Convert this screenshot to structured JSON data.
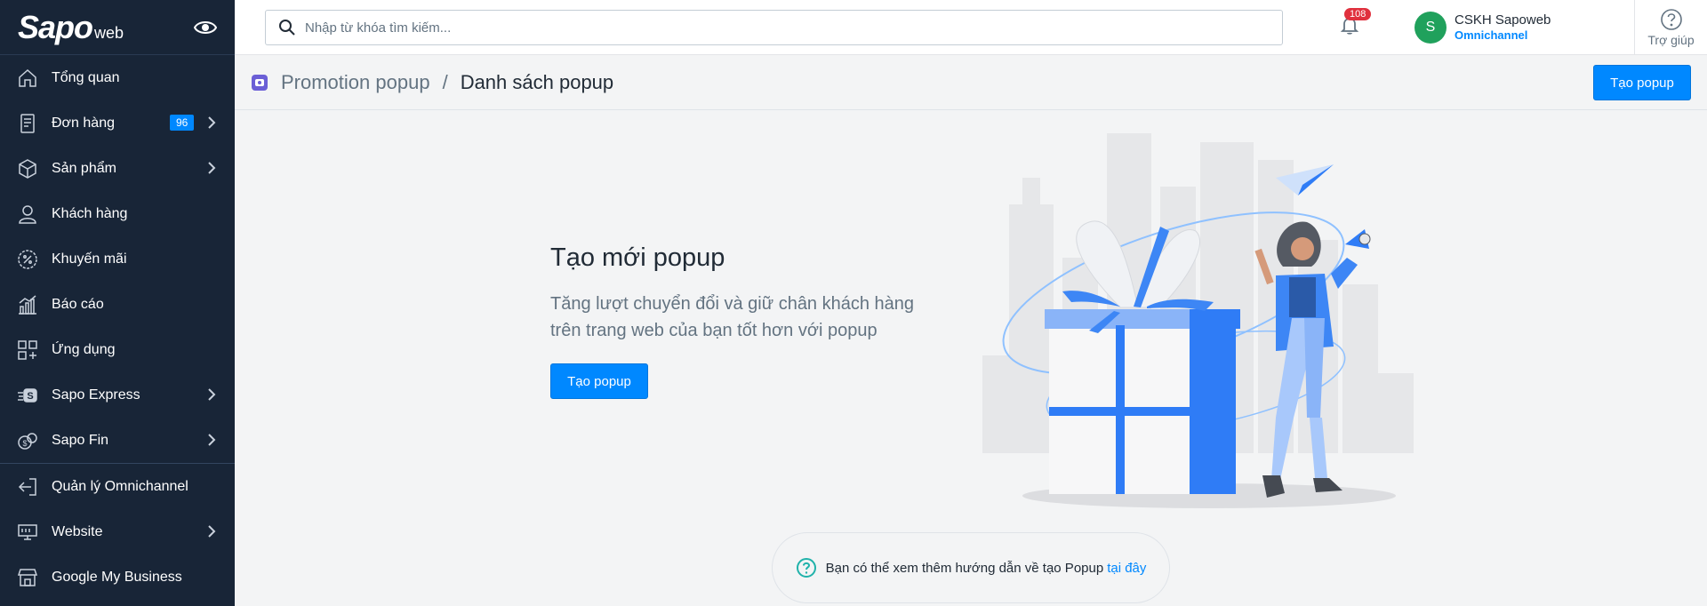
{
  "app": {
    "logo_main": "Sapo",
    "logo_sub": "web"
  },
  "sidebar": {
    "items": [
      {
        "label": "Tổng quan",
        "icon": "home-icon"
      },
      {
        "label": "Đơn hàng",
        "icon": "order-icon",
        "badge": "96"
      },
      {
        "label": "Sản phẩm",
        "icon": "box-icon"
      },
      {
        "label": "Khách hàng",
        "icon": "user-icon"
      },
      {
        "label": "Khuyến mãi",
        "icon": "discount-icon"
      },
      {
        "label": "Báo cáo",
        "icon": "chart-icon"
      },
      {
        "label": "Ứng dụng",
        "icon": "apps-icon"
      },
      {
        "label": "Sapo Express",
        "icon": "express-icon"
      },
      {
        "label": "Sapo Fin",
        "icon": "fin-icon"
      },
      {
        "label": "Quản lý Omnichannel",
        "icon": "omnichannel-icon"
      },
      {
        "label": "Website",
        "icon": "website-icon"
      },
      {
        "label": "Google My Business",
        "icon": "store-icon"
      }
    ]
  },
  "topbar": {
    "search_placeholder": "Nhập từ khóa tìm kiếm...",
    "notification_count": "108",
    "user_initial": "S",
    "user_name": "CSKH Sapoweb",
    "user_role": "Omnichannel",
    "help_label": "Trợ giúp"
  },
  "header": {
    "breadcrumb": "Promotion popup",
    "separator": "/",
    "title": "Danh sách popup",
    "create_button": "Tạo popup"
  },
  "empty_state": {
    "title": "Tạo mới popup",
    "description": "Tăng lượt chuyển đổi và giữ chân khách hàng trên trang web của bạn tốt hơn với popup",
    "button": "Tạo popup"
  },
  "hint": {
    "text": "Bạn có thể xem thêm hướng dẫn về tạo Popup",
    "link": "tại đây"
  },
  "colors": {
    "sidebar": "#182537",
    "primary": "#0088ff",
    "badge": "#e0313e",
    "avatar": "#20a15c"
  }
}
